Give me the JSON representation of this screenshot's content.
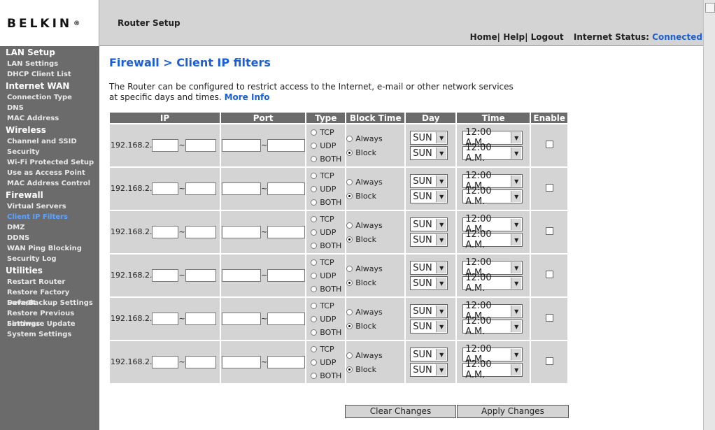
{
  "header": {
    "logo": "BELKIN",
    "logo_mark": "®",
    "router_setup": "Router Setup",
    "home": "Home",
    "help": "Help",
    "logout": "Logout",
    "sep": "|",
    "internet_status_label": "Internet Status:",
    "internet_status_value": "Connected"
  },
  "sidebar": {
    "sections": [
      {
        "title": "LAN Setup",
        "items": [
          "LAN Settings",
          "DHCP Client List"
        ]
      },
      {
        "title": "Internet WAN",
        "items": [
          "Connection Type",
          "DNS",
          "MAC Address"
        ]
      },
      {
        "title": "Wireless",
        "items": [
          "Channel and SSID",
          "Security",
          "Wi-Fi Protected Setup",
          "Use as Access Point",
          "MAC Address Control"
        ]
      },
      {
        "title": "Firewall",
        "items": [
          "Virtual Servers",
          "Client IP Filters",
          "DMZ",
          "DDNS",
          "WAN Ping Blocking",
          "Security Log"
        ]
      },
      {
        "title": "Utilities",
        "items": [
          "Restart Router",
          "Restore Factory Default",
          "Save/Backup Settings",
          "Restore Previous Settings",
          "Firmware Update",
          "System Settings"
        ]
      }
    ],
    "active": "Client IP Filters"
  },
  "page": {
    "title": "Firewall > Client IP filters",
    "description_line1": "The Router can be configured to restrict access to the Internet, e-mail or other network services",
    "description_line2": "at specific days and times.",
    "more_info": "More Info"
  },
  "table": {
    "headers": [
      "IP",
      "Port",
      "Type",
      "Block Time",
      "Day",
      "Time",
      "Enable"
    ],
    "ip_prefix": "192.168.2.",
    "tilde": "~",
    "type_options": [
      "TCP",
      "UDP",
      "BOTH"
    ],
    "block_options": [
      "Always",
      "Block"
    ],
    "block_selected": "Block",
    "day_value": "SUN",
    "time_value": "12:00 A.M.",
    "row_count": 6
  },
  "buttons": {
    "clear": "Clear Changes",
    "apply": "Apply Changes"
  },
  "colors": {
    "header_bg": "#d4d4d4",
    "sidebar_bg": "#6b6b6b",
    "accent": "#1a5fd8",
    "active_link": "#5fa3ff"
  }
}
